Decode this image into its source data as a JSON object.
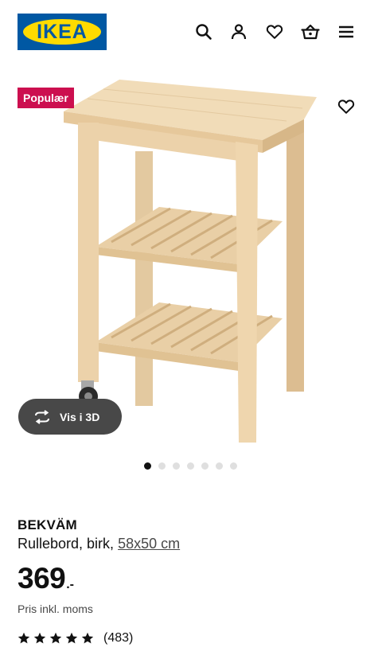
{
  "header": {
    "logo_text": "IKEA",
    "icons": [
      "search-icon",
      "user-icon",
      "heart-icon",
      "basket-icon",
      "menu-icon"
    ]
  },
  "product": {
    "badge": "Populær",
    "name": "BEKVÄM",
    "description": "Rullebord, birk,",
    "size": "58x50 cm",
    "price_int": "369",
    "price_dec": ".-",
    "price_note": "Pris inkl. moms",
    "rating_stars": 5,
    "review_count": "(483)"
  },
  "gallery": {
    "view3d_label": "Vis i 3D",
    "dot_count": 7,
    "active_dot": 0
  },
  "colors": {
    "brand_blue": "#0058a3",
    "brand_yellow": "#ffdb00",
    "badge_red": "#cc0f4f",
    "button_dark": "#484848"
  }
}
